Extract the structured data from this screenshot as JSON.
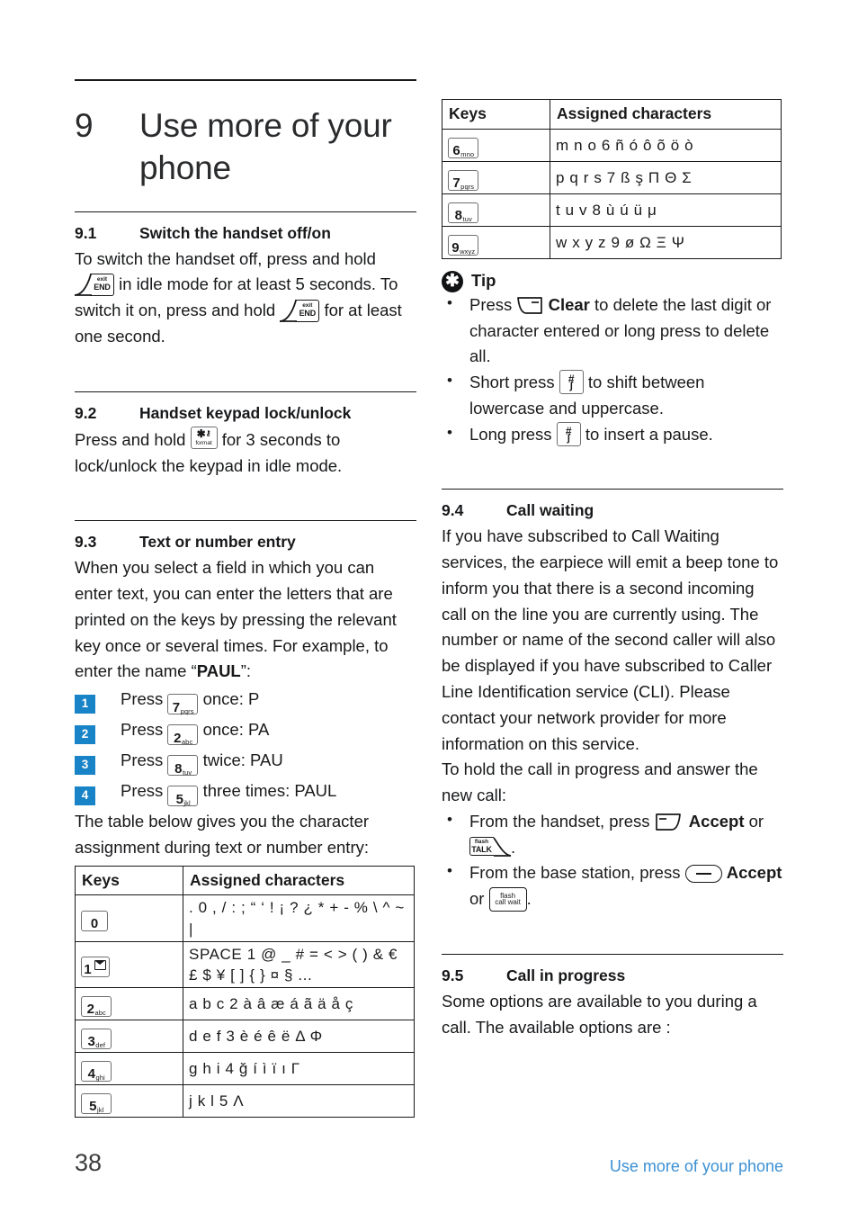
{
  "chapter": {
    "number": "9",
    "title": "Use more of your phone"
  },
  "sections": {
    "s91": {
      "num": "9.1",
      "title": "Switch the handset off/on",
      "p1a": "To switch the handset off, press and hold",
      "p1b": "in idle mode for at least 5 seconds. To switch it on, press and hold",
      "p1c": "for at least one second."
    },
    "s92": {
      "num": "9.2",
      "title": "Handset keypad lock/unlock",
      "p1a": "Press and hold",
      "p1b": "for 3 seconds to lock/unlock the keypad in idle mode."
    },
    "s93": {
      "num": "9.3",
      "title": "Text or number entry",
      "p1": "When you select a field in which you can enter text, you can enter the letters that are printed on the keys by pressing the relevant key once or several times. For example, to enter the name “",
      "p1_bold": "PAUL",
      "p1_end": "”:",
      "steps": [
        {
          "badge": "1",
          "pre": "Press",
          "post": "once: P"
        },
        {
          "badge": "2",
          "pre": "Press",
          "post": "once: PA"
        },
        {
          "badge": "3",
          "pre": "Press",
          "post": "twice: PAU"
        },
        {
          "badge": "4",
          "pre": "Press",
          "post": "three times: PAUL"
        }
      ],
      "p2": "The table below gives you the character assignment during text or number entry:"
    },
    "s94": {
      "num": "9.4",
      "title": "Call waiting",
      "p1": "If you have subscribed to Call Waiting services, the earpiece will emit a beep tone to inform you that there is a second incoming call on the line you are currently using. The number or name of the second caller will also be displayed if you have subscribed to Caller Line Identification service (CLI). Please contact your network provider for more information on this service.",
      "p2": "To hold the call in progress and answer the new call:",
      "bullet1_pre": "From the handset, press",
      "bullet1_bold": "Accept",
      "bullet1_or": "or",
      "bullet1_end": ".",
      "bullet2_pre": "From the base station, press",
      "bullet2_bold": "Accept",
      "bullet2_or": "or",
      "bullet2_end": "."
    },
    "s95": {
      "num": "9.5",
      "title": "Call in progress",
      "p1": "Some options are available to you during a call. The available options are :"
    }
  },
  "tip": {
    "icon": "asterisk-in-circle",
    "title": "Tip",
    "b1_pre": "Press",
    "b1_bold": "Clear",
    "b1_post": "to delete the last digit or character entered or long press to delete all.",
    "b2_pre": "Short press",
    "b2_post": "to shift between lowercase and uppercase.",
    "b3_pre": "Long press",
    "b3_post": "to insert a pause."
  },
  "table_left": {
    "headers": [
      "Keys",
      "Assigned characters"
    ],
    "rows": [
      {
        "key": {
          "digit": "0",
          "sub": ""
        },
        "chars": ". 0 , / : ;  “ ‘ ! ¡ ? ¿ * + - % \\ ^ ~ |"
      },
      {
        "key": {
          "digit": "1",
          "sub": "envelope"
        },
        "chars": "SPACE 1 @ _ # = < > ( ) & € £ $ ¥ [ ] { } ¤ § ..."
      },
      {
        "key": {
          "digit": "2",
          "sub": "abc"
        },
        "chars": "a b c 2 à â æ á ã ä å ç"
      },
      {
        "key": {
          "digit": "3",
          "sub": "def"
        },
        "chars": "d e f 3 è é ê ë Δ Φ"
      },
      {
        "key": {
          "digit": "4",
          "sub": "ghi"
        },
        "chars": "g h i 4 ğ í ì ï ı Γ"
      },
      {
        "key": {
          "digit": "5",
          "sub": "jkl"
        },
        "chars": "j k l 5 Λ"
      }
    ]
  },
  "table_right": {
    "headers": [
      "Keys",
      "Assigned characters"
    ],
    "rows": [
      {
        "key": {
          "digit": "6",
          "sub": "mno"
        },
        "chars": "m n o 6 ñ ó ô õ ö ò"
      },
      {
        "key": {
          "digit": "7",
          "sub": "pqrs"
        },
        "chars": "p q r s 7 ß ş Π Θ Σ"
      },
      {
        "key": {
          "digit": "8",
          "sub": "tuv"
        },
        "chars": "t u v 8 ù ú ü μ"
      },
      {
        "key": {
          "digit": "9",
          "sub": "wxyz"
        },
        "chars": "w x y z 9 ø Ω Ξ Ψ"
      }
    ]
  },
  "keys": {
    "end": {
      "top": "exit",
      "bottom": "END"
    },
    "talk": {
      "top": "flash",
      "bottom": "TALK"
    },
    "star": {
      "bottom": "format"
    },
    "hash": {
      "top": "#",
      "bottom": "ʃ"
    },
    "flash_call_wait": {
      "r1": "flash",
      "r2": "call wait"
    },
    "k7": {
      "digit": "7",
      "sub": "pqrs"
    },
    "k2": {
      "digit": "2",
      "sub": "abc"
    },
    "k8": {
      "digit": "8",
      "sub": "tuv"
    },
    "k5": {
      "digit": "5",
      "sub": "jkl"
    }
  },
  "footer": {
    "page": "38",
    "running_head": "Use more of your phone",
    "running_head_color": "#3b90d4"
  },
  "colors": {
    "badge_blue": "#1983c7",
    "text": "#17181a",
    "rule": "#17181a"
  }
}
